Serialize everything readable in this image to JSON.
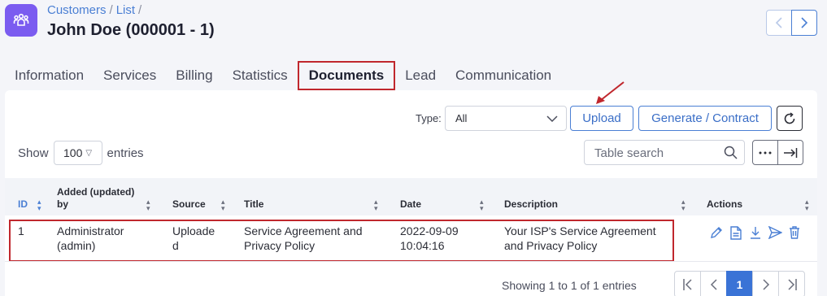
{
  "header": {
    "breadcrumb": [
      "Customers",
      "List"
    ],
    "title": "John Doe (000001 - 1)"
  },
  "tabs": [
    "Information",
    "Services",
    "Billing",
    "Statistics",
    "Documents",
    "Lead",
    "Communication"
  ],
  "active_tab": "Documents",
  "toolbar": {
    "type_label": "Type:",
    "type_value": "All",
    "upload_label": "Upload",
    "generate_label": "Generate / Contract"
  },
  "entries": {
    "show_label": "Show",
    "value": "100",
    "suffix": "entries"
  },
  "search": {
    "placeholder": "Table search"
  },
  "table": {
    "columns": [
      "ID",
      "Added (updated) by",
      "Source",
      "Title",
      "Date",
      "Description",
      "Actions"
    ],
    "rows": [
      {
        "id": "1",
        "added_by_line1": "Administrator",
        "added_by_line2": "(admin)",
        "source_line1": "Uploade",
        "source_line2": "d",
        "title_line1": "Service Agreement and",
        "title_line2": "Privacy Policy",
        "date_line1": "2022-09-09",
        "date_line2": "10:04:16",
        "description_line1": "Your ISP's Service Agreement",
        "description_line2": "and Privacy Policy"
      }
    ]
  },
  "footer": {
    "info": "Showing 1 to 1 of 1 entries",
    "current_page": "1"
  },
  "colors": {
    "accent": "#4a7fd4",
    "highlight": "#c0272d",
    "app_icon": "#7b5cf0"
  }
}
